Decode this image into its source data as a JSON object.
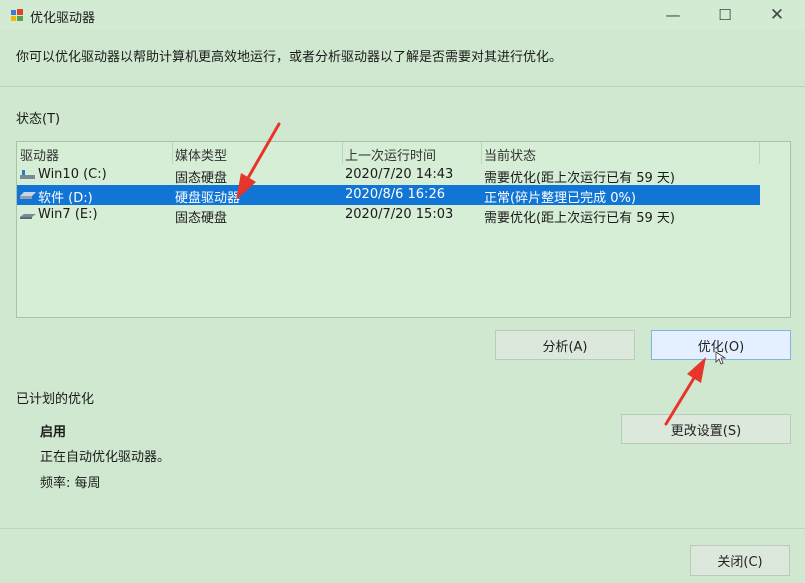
{
  "window": {
    "title": "优化驱动器",
    "minimize_glyph": "—",
    "maximize_glyph": "☐",
    "close_glyph": "✕"
  },
  "description": "你可以优化驱动器以帮助计算机更高效地运行，或者分析驱动器以了解是否需要对其进行优化。",
  "status": {
    "label": "状态(T)",
    "columns": [
      "驱动器",
      "媒体类型",
      "上一次运行时间",
      "当前状态"
    ],
    "rows": [
      {
        "drive": "Win10 (C:)",
        "media": "固态硬盘",
        "last_run": "2020/7/20 14:43",
        "status": "需要优化(距上次运行已有 59 天)",
        "icon": "ssd-drive-icon",
        "selected": false
      },
      {
        "drive": "软件 (D:)",
        "media": "硬盘驱动器",
        "last_run": "2020/8/6 16:26",
        "status": "正常(碎片整理已完成 0%)",
        "icon": "hdd-drive-icon",
        "selected": true
      },
      {
        "drive": "Win7 (E:)",
        "media": "固态硬盘",
        "last_run": "2020/7/20 15:03",
        "status": "需要优化(距上次运行已有 59 天)",
        "icon": "ssd-drive-icon",
        "selected": false
      }
    ]
  },
  "actions": {
    "analyze": "分析(A)",
    "optimize": "优化(O)"
  },
  "schedule": {
    "label": "已计划的优化",
    "enabled": "启用",
    "description": "正在自动优化驱动器。",
    "frequency": "频率: 每周",
    "change_settings": "更改设置(S)"
  },
  "footer": {
    "close": "关闭(C)"
  },
  "colors": {
    "background": "#cfe8cf",
    "selection": "#1175d6",
    "annotation_arrow": "#e8352b"
  }
}
